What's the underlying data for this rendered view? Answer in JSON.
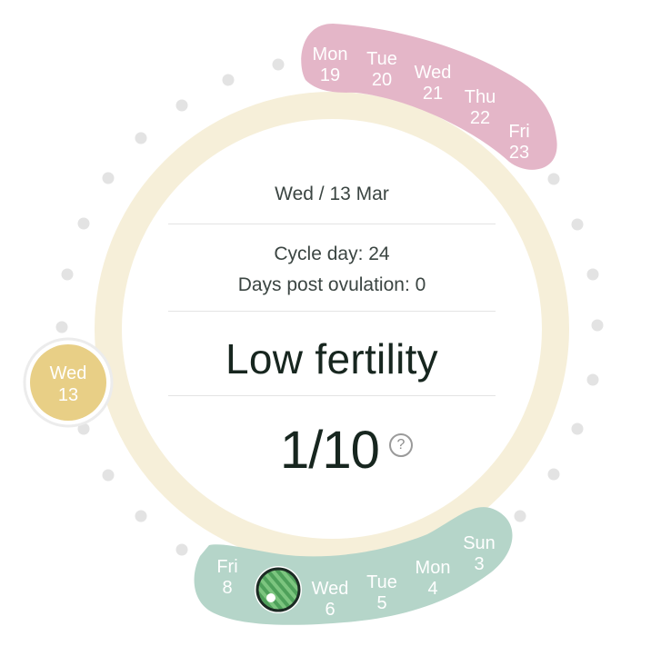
{
  "header": {
    "date_label": "Wed / 13 Mar"
  },
  "stats": {
    "cycle_day": "Cycle day: 24",
    "days_post_ovulation": "Days post ovulation: 0"
  },
  "fertility": {
    "status": "Low fertility",
    "score": "1/10",
    "help_icon": "question-circle-icon",
    "help_glyph": "?"
  },
  "selected_day": {
    "weekday": "Wed",
    "day": "13"
  },
  "predicted_period": [
    {
      "weekday": "Mon",
      "day": "19"
    },
    {
      "weekday": "Tue",
      "day": "20"
    },
    {
      "weekday": "Wed",
      "day": "21"
    },
    {
      "weekday": "Thu",
      "day": "22"
    },
    {
      "weekday": "Fri",
      "day": "23"
    }
  ],
  "past_days": [
    {
      "weekday": "Fri",
      "day": "8"
    },
    {
      "weekday": "Wed",
      "day": "6"
    },
    {
      "weekday": "Tue",
      "day": "5"
    },
    {
      "weekday": "Mon",
      "day": "4"
    },
    {
      "weekday": "Sun",
      "day": "3"
    }
  ],
  "colors": {
    "ring": "#f6efd9",
    "period_band": "#e4b6c8",
    "past_band": "#b5d5c9",
    "selected_fill": "#e8cf86",
    "dot": "#e3e3e3",
    "text_dark": "#17261f",
    "ovulation_marker": "#4ea05a"
  }
}
